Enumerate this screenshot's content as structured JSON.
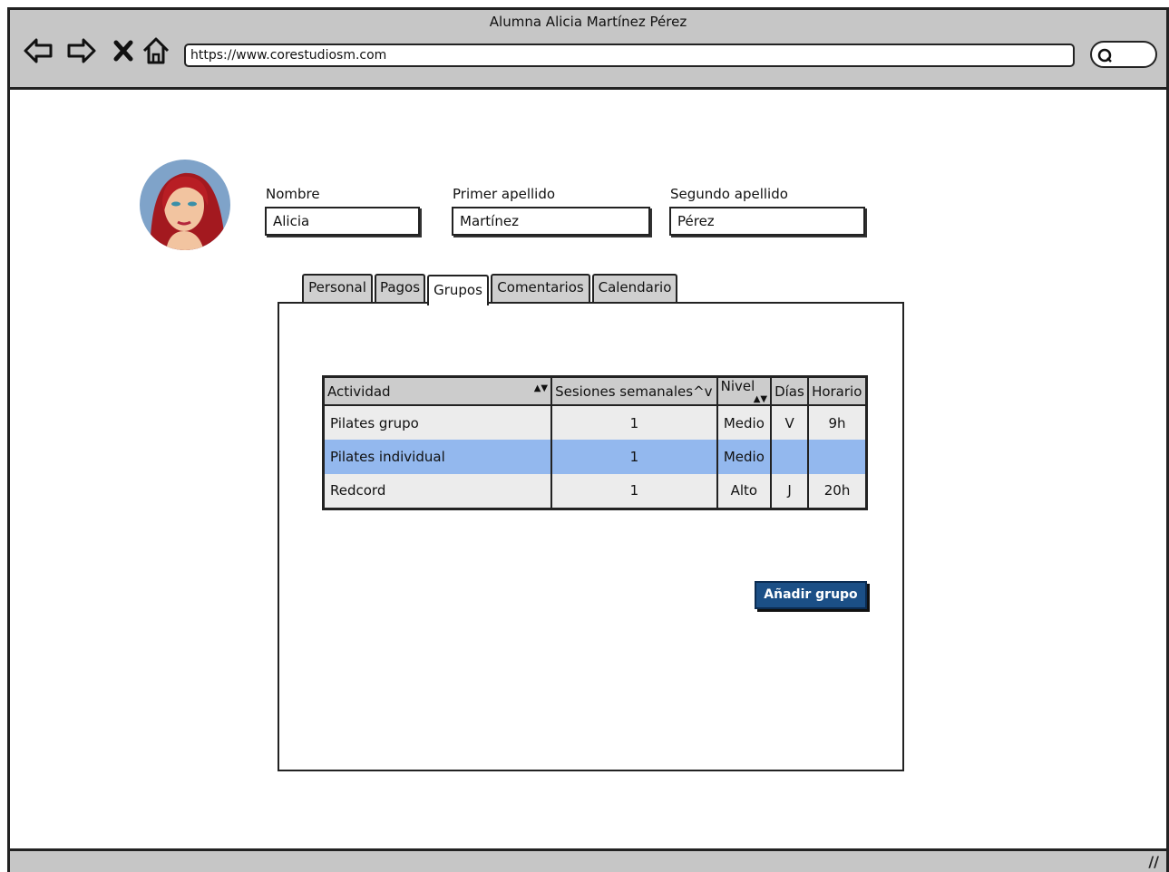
{
  "window": {
    "title": "Alumna Alicia Martínez Pérez",
    "url": "https://www.corestudiosm.com"
  },
  "toolbar": {
    "icons": [
      "back-arrow-icon",
      "forward-arrow-icon",
      "close-icon",
      "home-icon",
      "search-icon"
    ]
  },
  "profile": {
    "fields": {
      "nombre_label": "Nombre",
      "nombre_value": "Alicia",
      "primer_label": "Primer apellido",
      "primer_value": "Martínez",
      "segundo_label": "Segundo apellido",
      "segundo_value": "Pérez"
    }
  },
  "tabs": {
    "items": [
      "Personal",
      "Pagos",
      "Grupos",
      "Comentarios",
      "Calendario"
    ],
    "active": "Grupos"
  },
  "groups_table": {
    "headers": [
      "Actividad",
      "Sesiones semanales^v",
      "Nivel",
      "Días",
      "Horario"
    ],
    "rows": [
      {
        "actividad": "Pilates grupo",
        "sesiones": "1",
        "nivel": "Medio",
        "dias": "V",
        "horario": "9h"
      },
      {
        "actividad": "Pilates individual",
        "sesiones": "1",
        "nivel": "Medio",
        "dias": "",
        "horario": ""
      },
      {
        "actividad": "Redcord",
        "sesiones": "1",
        "nivel": "Alto",
        "dias": "J",
        "horario": "20h"
      }
    ],
    "selected_row": 1,
    "selected_color": "#93b8ee"
  },
  "actions": {
    "add_group_label": "Añadir grupo",
    "add_group_color": "#1b4f86"
  }
}
